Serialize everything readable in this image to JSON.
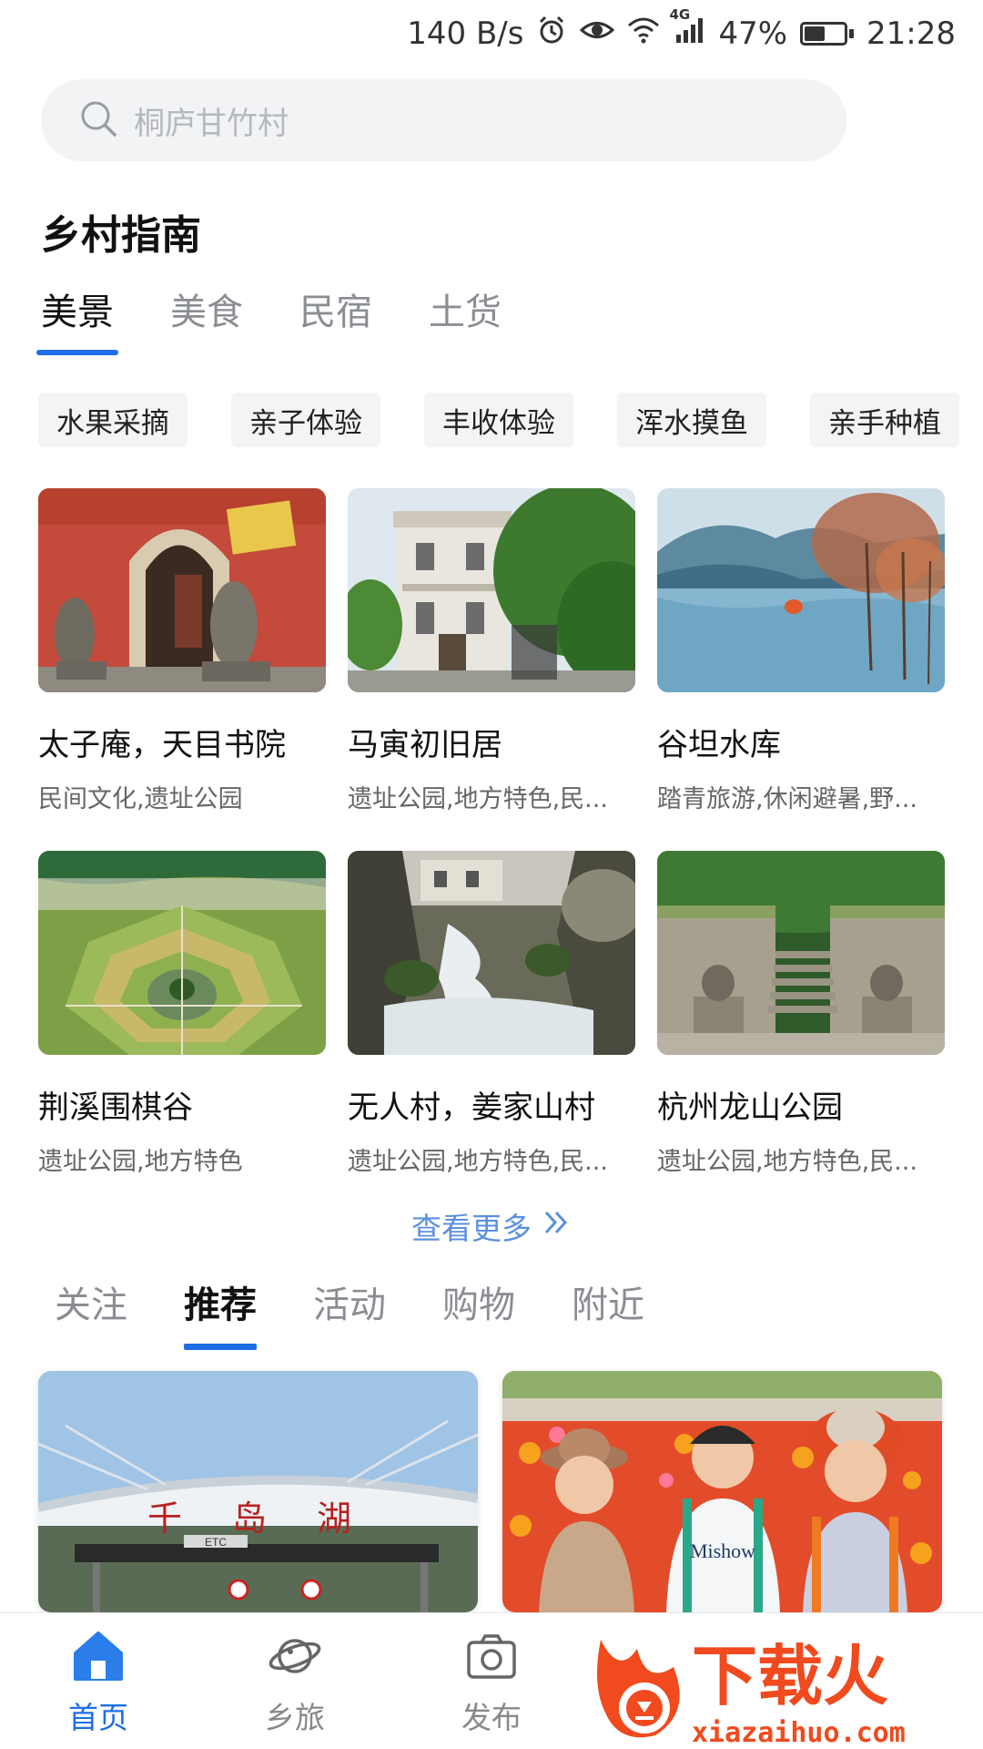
{
  "status_bar": {
    "net_speed": "140 B/s",
    "network": "4G",
    "battery": "47%",
    "time": "21:28"
  },
  "search": {
    "placeholder": "桐庐甘竹村"
  },
  "guide": {
    "title": "乡村指南",
    "tabs": [
      {
        "label": "美景",
        "active": true
      },
      {
        "label": "美食",
        "active": false
      },
      {
        "label": "民宿",
        "active": false
      },
      {
        "label": "土货",
        "active": false
      }
    ],
    "chips": [
      "水果采摘",
      "亲子体验",
      "丰收体验",
      "浑水摸鱼",
      "亲手种植"
    ],
    "cards": [
      {
        "name": "太子庵，天目书院",
        "tags": "民间文化,遗址公园"
      },
      {
        "name": "马寅初旧居",
        "tags": "遗址公园,地方特色,民..."
      },
      {
        "name": "谷坦水库",
        "tags": "踏青旅游,休闲避暑,野..."
      },
      {
        "name": "荆溪围棋谷",
        "tags": "遗址公园,地方特色"
      },
      {
        "name": "无人村，姜家山村",
        "tags": "遗址公园,地方特色,民..."
      },
      {
        "name": "杭州龙山公园",
        "tags": "遗址公园,地方特色,民..."
      }
    ],
    "more_label": "查看更多"
  },
  "feed": {
    "tabs": [
      {
        "label": "关注",
        "active": false
      },
      {
        "label": "推荐",
        "active": true
      },
      {
        "label": "活动",
        "active": false
      },
      {
        "label": "购物",
        "active": false
      },
      {
        "label": "附近",
        "active": false
      }
    ],
    "toll_sign_text": "千岛湖",
    "toll_sub_text": "ETC",
    "shirt_text": "Mishow"
  },
  "bottom_nav": [
    {
      "label": "首页",
      "icon": "home-icon",
      "active": true
    },
    {
      "label": "乡旅",
      "icon": "planet-icon",
      "active": false
    },
    {
      "label": "发布",
      "icon": "camera-icon",
      "active": false
    }
  ],
  "watermark": {
    "brand": "下载火",
    "url": "xiazaihuo.com"
  },
  "colors": {
    "accent": "#1e6ee8",
    "search_bg": "#f2f3f5",
    "chip_bg": "#f2f4f6",
    "watermark": "#f04a1e"
  }
}
